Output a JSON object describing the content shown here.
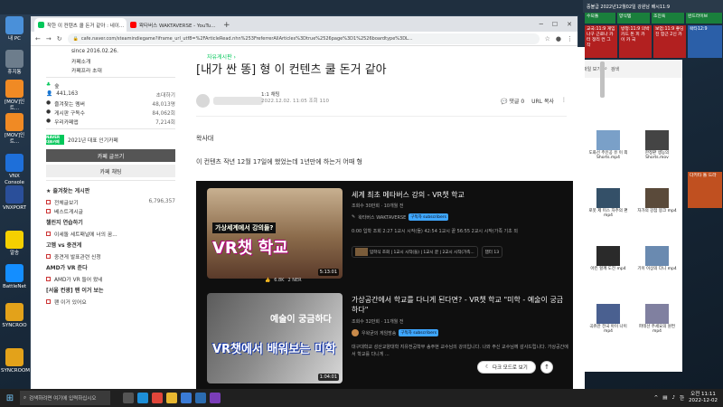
{
  "desktop": {
    "icons": [
      {
        "label": "내 PC",
        "color": "#4a90d9"
      },
      {
        "label": "휴지통",
        "color": "#6d7d8c"
      },
      {
        "label": "[MOV]인트...",
        "color": "#f08a24"
      },
      {
        "label": "[MOV]인트...",
        "color": "#f08a24"
      },
      {
        "label": "VNX Console",
        "color": "#1e6fd9"
      },
      {
        "label": "VNXPORT",
        "color": "#2a4f9a"
      },
      {
        "label": "알송",
        "color": "#f5d000"
      },
      {
        "label": "BattleNet",
        "color": "#148eff"
      },
      {
        "label": "SYNCROO",
        "color": "#e3a21a"
      },
      {
        "label": "SYNCROOM",
        "color": "#e3a21a"
      }
    ]
  },
  "browser": {
    "tabs": [
      {
        "label": "착한 이 컨텐츠 쿨 돈거 같아 : 네이...",
        "favicon_color": "#03c75a",
        "active": true
      },
      {
        "label": "왁타버스 WAKTAVERSE - YouTu...",
        "favicon_color": "#ff0000",
        "active": false
      }
    ],
    "new_tab": "+",
    "url": "cafe.naver.com/steamindiegame?iframe_url_utf8=%2FArticleRead.nhn%253FreferrerAllArticles%3Dtrue%2526page%3D1%2526boardtype%3DL..."
  },
  "sidebar": {
    "since": "since 2016.02.26.",
    "cafe_info": "카페소개",
    "invite": "카페프라 초대",
    "rank": "숲",
    "members": "441,163",
    "invite_label": "초대하기",
    "stats": [
      {
        "label": "즐겨찾는 멤버",
        "value": "48,013명"
      },
      {
        "label": "게시판 구독수",
        "value": "84,062회"
      },
      {
        "label": "우리카페앱",
        "value": "7,214회"
      }
    ],
    "year_badge": "NAVER 대표카페",
    "year_text": "2021년 대표 인기카페",
    "write_button": "카페 글쓰기",
    "chat_button": "카페 채팅",
    "fav_header": "즐겨찾는 게시판",
    "boards": [
      {
        "label": "전체글보기",
        "count": "6,796,357"
      },
      {
        "label": "베스트게시글",
        "count": ""
      }
    ],
    "section1": "챌린지 연습하기",
    "section1_item": "이세돌 세트패널에 너의 꿈...",
    "section2": "고멤 vs 중견게",
    "section2_item": "중견게 발표관련 신청",
    "section3": "AMD가 VR 준다",
    "section3_item": "AMD가 VR 들어 왔네",
    "section4": "[서울 컨광] 팬 이거 보는",
    "section4_item": "팬 이거 있어요"
  },
  "article": {
    "board": "자유게시판",
    "title": "[내가 싼 똥] 형 이 컨텐츠 쿨 돈거 같아",
    "grade": "1:1 채팅",
    "date": "2022.12.02. 11:05 조회 110",
    "comment": "댓글 0",
    "url_copy": "URL 복사",
    "paragraph1": "왁사대",
    "paragraph2": "이 컨텐츠 작년 12월 17일에 했었는데 1년만에 하는거 어때 형"
  },
  "videos": [
    {
      "thumb_text": "가상세계에서 강의들?",
      "big_text": "VR챗 학교",
      "duration": "5:13:01",
      "title": "세계 최초 메타버스 강의 - VR챗 학교",
      "stats": "조회수 30만회 · 10개월 전",
      "channel": "왁타버스 WAKTAVERSE",
      "sub": "구독자 subscribers",
      "desc": "0:00 입학 조회 2:27 1교시 시작(들) 42:54 1교시 끝 56:55 2교시 시작(가족 기초 외",
      "chapters": [
        "입학식 조회 | 1교시 시작(들) | 1교시 끝 | 2교시 시작(가족...",
        "챕터 13"
      ],
      "likes": "6.8K",
      "dislike": "2 NER"
    },
    {
      "thumb_text": "예술이 궁금하다",
      "big_text": "VR챗에서 배워보는 미학",
      "duration": "1:04:01",
      "title": "가상공간에서 학교를 다니게 된다면? - VR챗 학교 \"미학 - 예술이 궁금하다\"",
      "stats": "조회수 32만회 · 11개월 전",
      "channel": "우왁굳의 게임방송",
      "sub": "구독자 subscribers",
      "desc": "대구대학교 성산교양대학 지유전공학부 송주현 교수님의 강의입니다. 나와 주신 교수님께 감사드립니다. 가상공간에서 학교를 다니게 ..."
    }
  ],
  "floating": {
    "dark_mode": "다크 모드로 보기",
    "to_top": "↑"
  },
  "right_panel": {
    "top_text": "중볼급 2022년12월02일 강원남 배시11:9",
    "tiles": [
      {
        "text": "수되돌",
        "color": "#1a7f3c"
      },
      {
        "text": "양식템",
        "color": "#1a7f3c"
      },
      {
        "text": "조진욱",
        "color": "#1a7f3c"
      },
      {
        "text": "완드라이브",
        "color": "#1a7f3c"
      },
      {
        "text": "교국:11:9 게임나구 근로나 카터 정리 컨 그 작",
        "color": "#b22020"
      },
      {
        "text": "방청:11:9 의박 카드 돈 피 카 이 카 국",
        "color": "#b22020"
      },
      {
        "text": "보업:11:9 좋딩진 합근 2신 카",
        "color": "#b22020"
      },
      {
        "text": "왁타12:9",
        "color": "#2b5fa8"
      },
      {
        "text": "다키타 돌 드라",
        "color": "#c05020"
      }
    ]
  },
  "explorer": {
    "head": "파일 보기",
    "search": "검색",
    "files": [
      {
        "label": "도화선 주인공 유 이 외 Shorts.mp4",
        "color": "#7aa0c8"
      },
      {
        "label": "한정판 생능의 Shorts.mov",
        "color": "#444444"
      },
      {
        "label": "로봇 제 미스 자주의 편 mp4",
        "color": "#345068"
      },
      {
        "label": "자가의 강점 몽크 mp4",
        "color": "#5a4a3a"
      },
      {
        "label": "아킨 할께 도전 mp4",
        "color": "#2a2a2a"
      },
      {
        "label": "기이 이상의 다니 mp4",
        "color": "#6a8ab0"
      },
      {
        "label": "곡쥬만 전국 아이 나이 mp4",
        "color": "#4a6090"
      },
      {
        "label": "파테선 주세요의 원컨 mp4",
        "color": "#8080a0"
      }
    ]
  },
  "taskbar": {
    "search_placeholder": "검색하려면 여기에 입력하십시오",
    "time": "오전 11:11",
    "date": "2022-12-02",
    "lang": "한"
  }
}
